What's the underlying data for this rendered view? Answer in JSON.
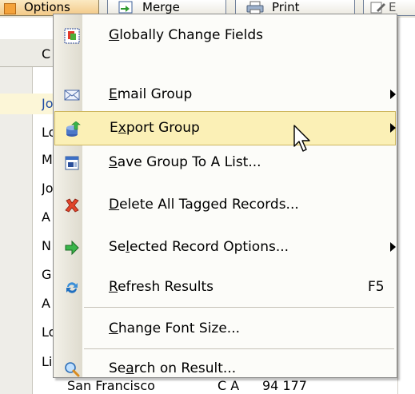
{
  "toolbar": {
    "options_label": "Options",
    "merge_label": "Merge",
    "print_label": "Print",
    "extra_label": "E"
  },
  "grid": {
    "header_letter": "C",
    "rows": [
      "Jo",
      "Lo",
      "M",
      "Jo",
      "A",
      "N",
      "G",
      "A",
      "Lo",
      "Li"
    ],
    "bottom_text": "San Francisco",
    "bottom_text2": "C A",
    "bottom_text3": "94 177"
  },
  "menu": {
    "items": [
      {
        "pre": "",
        "ul": "G",
        "post": "lobally Change Fields",
        "icon": "change-fields-icon"
      },
      {
        "pre": "",
        "ul": "E",
        "post": "mail Group",
        "icon": "envelope-icon",
        "submenu": true
      },
      {
        "pre": "E",
        "ul": "x",
        "post": "port Group",
        "icon": "export-icon",
        "submenu": true,
        "highlighted": true
      },
      {
        "pre": "",
        "ul": "S",
        "post": "ave Group To A List...",
        "icon": "save-list-icon"
      },
      {
        "pre": "",
        "ul": "D",
        "post": "elete All Tagged Records...",
        "icon": "delete-x-icon"
      },
      {
        "pre": "Se",
        "ul": "l",
        "post": "ected Record Options...",
        "icon": "green-arrow-icon",
        "submenu": true
      },
      {
        "pre": "",
        "ul": "R",
        "post": "efresh Results",
        "icon": "refresh-icon",
        "shortcut": "F5"
      },
      {
        "pre": "",
        "ul": "C",
        "post": "hange Font Size...",
        "icon": "font-size-icon"
      },
      {
        "pre": "Se",
        "ul": "a",
        "post": "rch on Result...",
        "icon": "magnifier-icon"
      }
    ]
  },
  "colors": {
    "highlight_bg": "#fbf0b6",
    "highlight_border": "#cdb65e",
    "selected_row_text": "#1d4aa3"
  }
}
